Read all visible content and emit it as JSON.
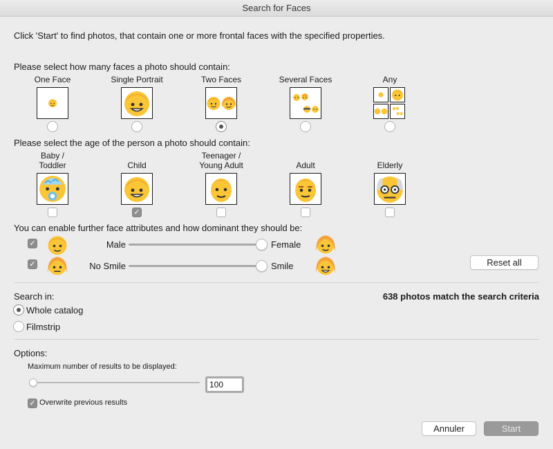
{
  "window": {
    "title": "Search for Faces"
  },
  "intro": "Click 'Start' to find photos, that contain one or more frontal faces with the specified properties.",
  "count_section": {
    "heading": "Please select how many faces a photo should contain:",
    "options": [
      {
        "label": "One Face",
        "icon": "one-face-icon",
        "selected": false
      },
      {
        "label": "Single Portrait",
        "icon": "single-portrait-icon",
        "selected": false
      },
      {
        "label": "Two Faces",
        "icon": "two-faces-icon",
        "selected": true
      },
      {
        "label": "Several Faces",
        "icon": "several-faces-icon",
        "selected": false
      },
      {
        "label": "Any",
        "icon": "any-faces-icon",
        "selected": false
      }
    ]
  },
  "age_section": {
    "heading": "Please select the age of the person a photo should contain:",
    "options": [
      {
        "label_line1": "Baby /",
        "label_line2": "Toddler",
        "icon": "baby-face-icon",
        "checked": false
      },
      {
        "label_line1": "",
        "label_line2": "Child",
        "icon": "child-face-icon",
        "checked": true
      },
      {
        "label_line1": "Teenager /",
        "label_line2": "Young Adult",
        "icon": "teen-face-icon",
        "checked": false
      },
      {
        "label_line1": "",
        "label_line2": "Adult",
        "icon": "adult-face-icon",
        "checked": false
      },
      {
        "label_line1": "",
        "label_line2": "Elderly",
        "icon": "elderly-face-icon",
        "checked": false
      }
    ]
  },
  "attributes": {
    "heading": "You can enable further face attributes and how dominant they should be:",
    "rows": [
      {
        "enabled": true,
        "left": "Male",
        "right": "Female",
        "value": 1.0,
        "left_icon": "male-face-icon",
        "right_icon": "female-face-icon"
      },
      {
        "enabled": true,
        "left": "No Smile",
        "right": "Smile",
        "value": 1.0,
        "left_icon": "no-smile-face-icon",
        "right_icon": "smile-face-icon"
      }
    ],
    "reset_label": "Reset all"
  },
  "search_in": {
    "heading": "Search in:",
    "options": [
      {
        "label": "Whole catalog",
        "selected": true
      },
      {
        "label": "Filmstrip",
        "selected": false
      }
    ],
    "match_text": "638 photos match the search criteria"
  },
  "options": {
    "heading": "Options:",
    "max_results_label": "Maximum number of results to be displayed:",
    "max_results_value": "100",
    "max_results_slider_fraction": 0.03,
    "overwrite_label": "Overwrite previous results",
    "overwrite_checked": true
  },
  "footer": {
    "cancel_label": "Annuler",
    "start_label": "Start"
  },
  "colors": {
    "face": "#fac536",
    "hair": "#f0a02a",
    "female_hair": "#f4a23a",
    "skin_pink": "#fbd3a8"
  }
}
